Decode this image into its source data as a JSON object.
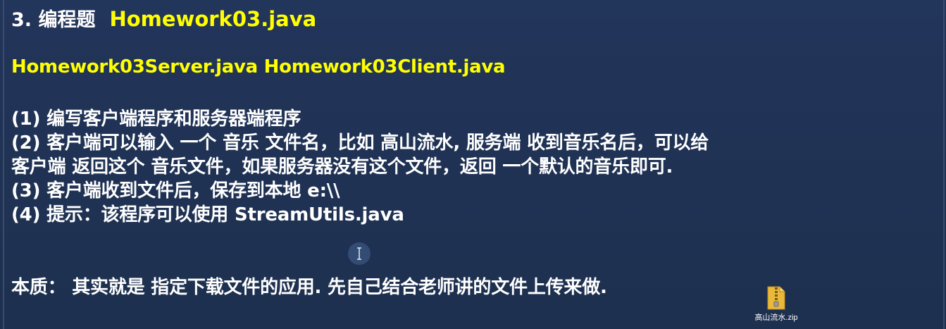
{
  "title": {
    "label": "3. 编程题",
    "file": "Homework03.java"
  },
  "files_line": "Homework03Server.java Homework03Client.java",
  "requirements": [
    "(1) 编写客户端程序和服务器端程序",
    "(2) 客户端可以输入 一个 音乐 文件名，比如  高山流水, 服务端 收到音乐名后，可以给",
    "客户端 返回这个 音乐文件，如果服务器没有这个文件，返回 一个默认的音乐即可.",
    "(3) 客户端收到文件后，保存到本地 e:\\\\",
    "(4) 提示：该程序可以使用 StreamUtils.java"
  ],
  "essence": "本质：  其实就是 指定下载文件的应用. 先自己结合老师讲的文件上传来做.",
  "zip_file": {
    "icon": "zip-archive-icon",
    "label": "高山流水.zip"
  },
  "colors": {
    "background": "#1f3050",
    "highlight": "#ffff00",
    "text": "#ffffff"
  }
}
